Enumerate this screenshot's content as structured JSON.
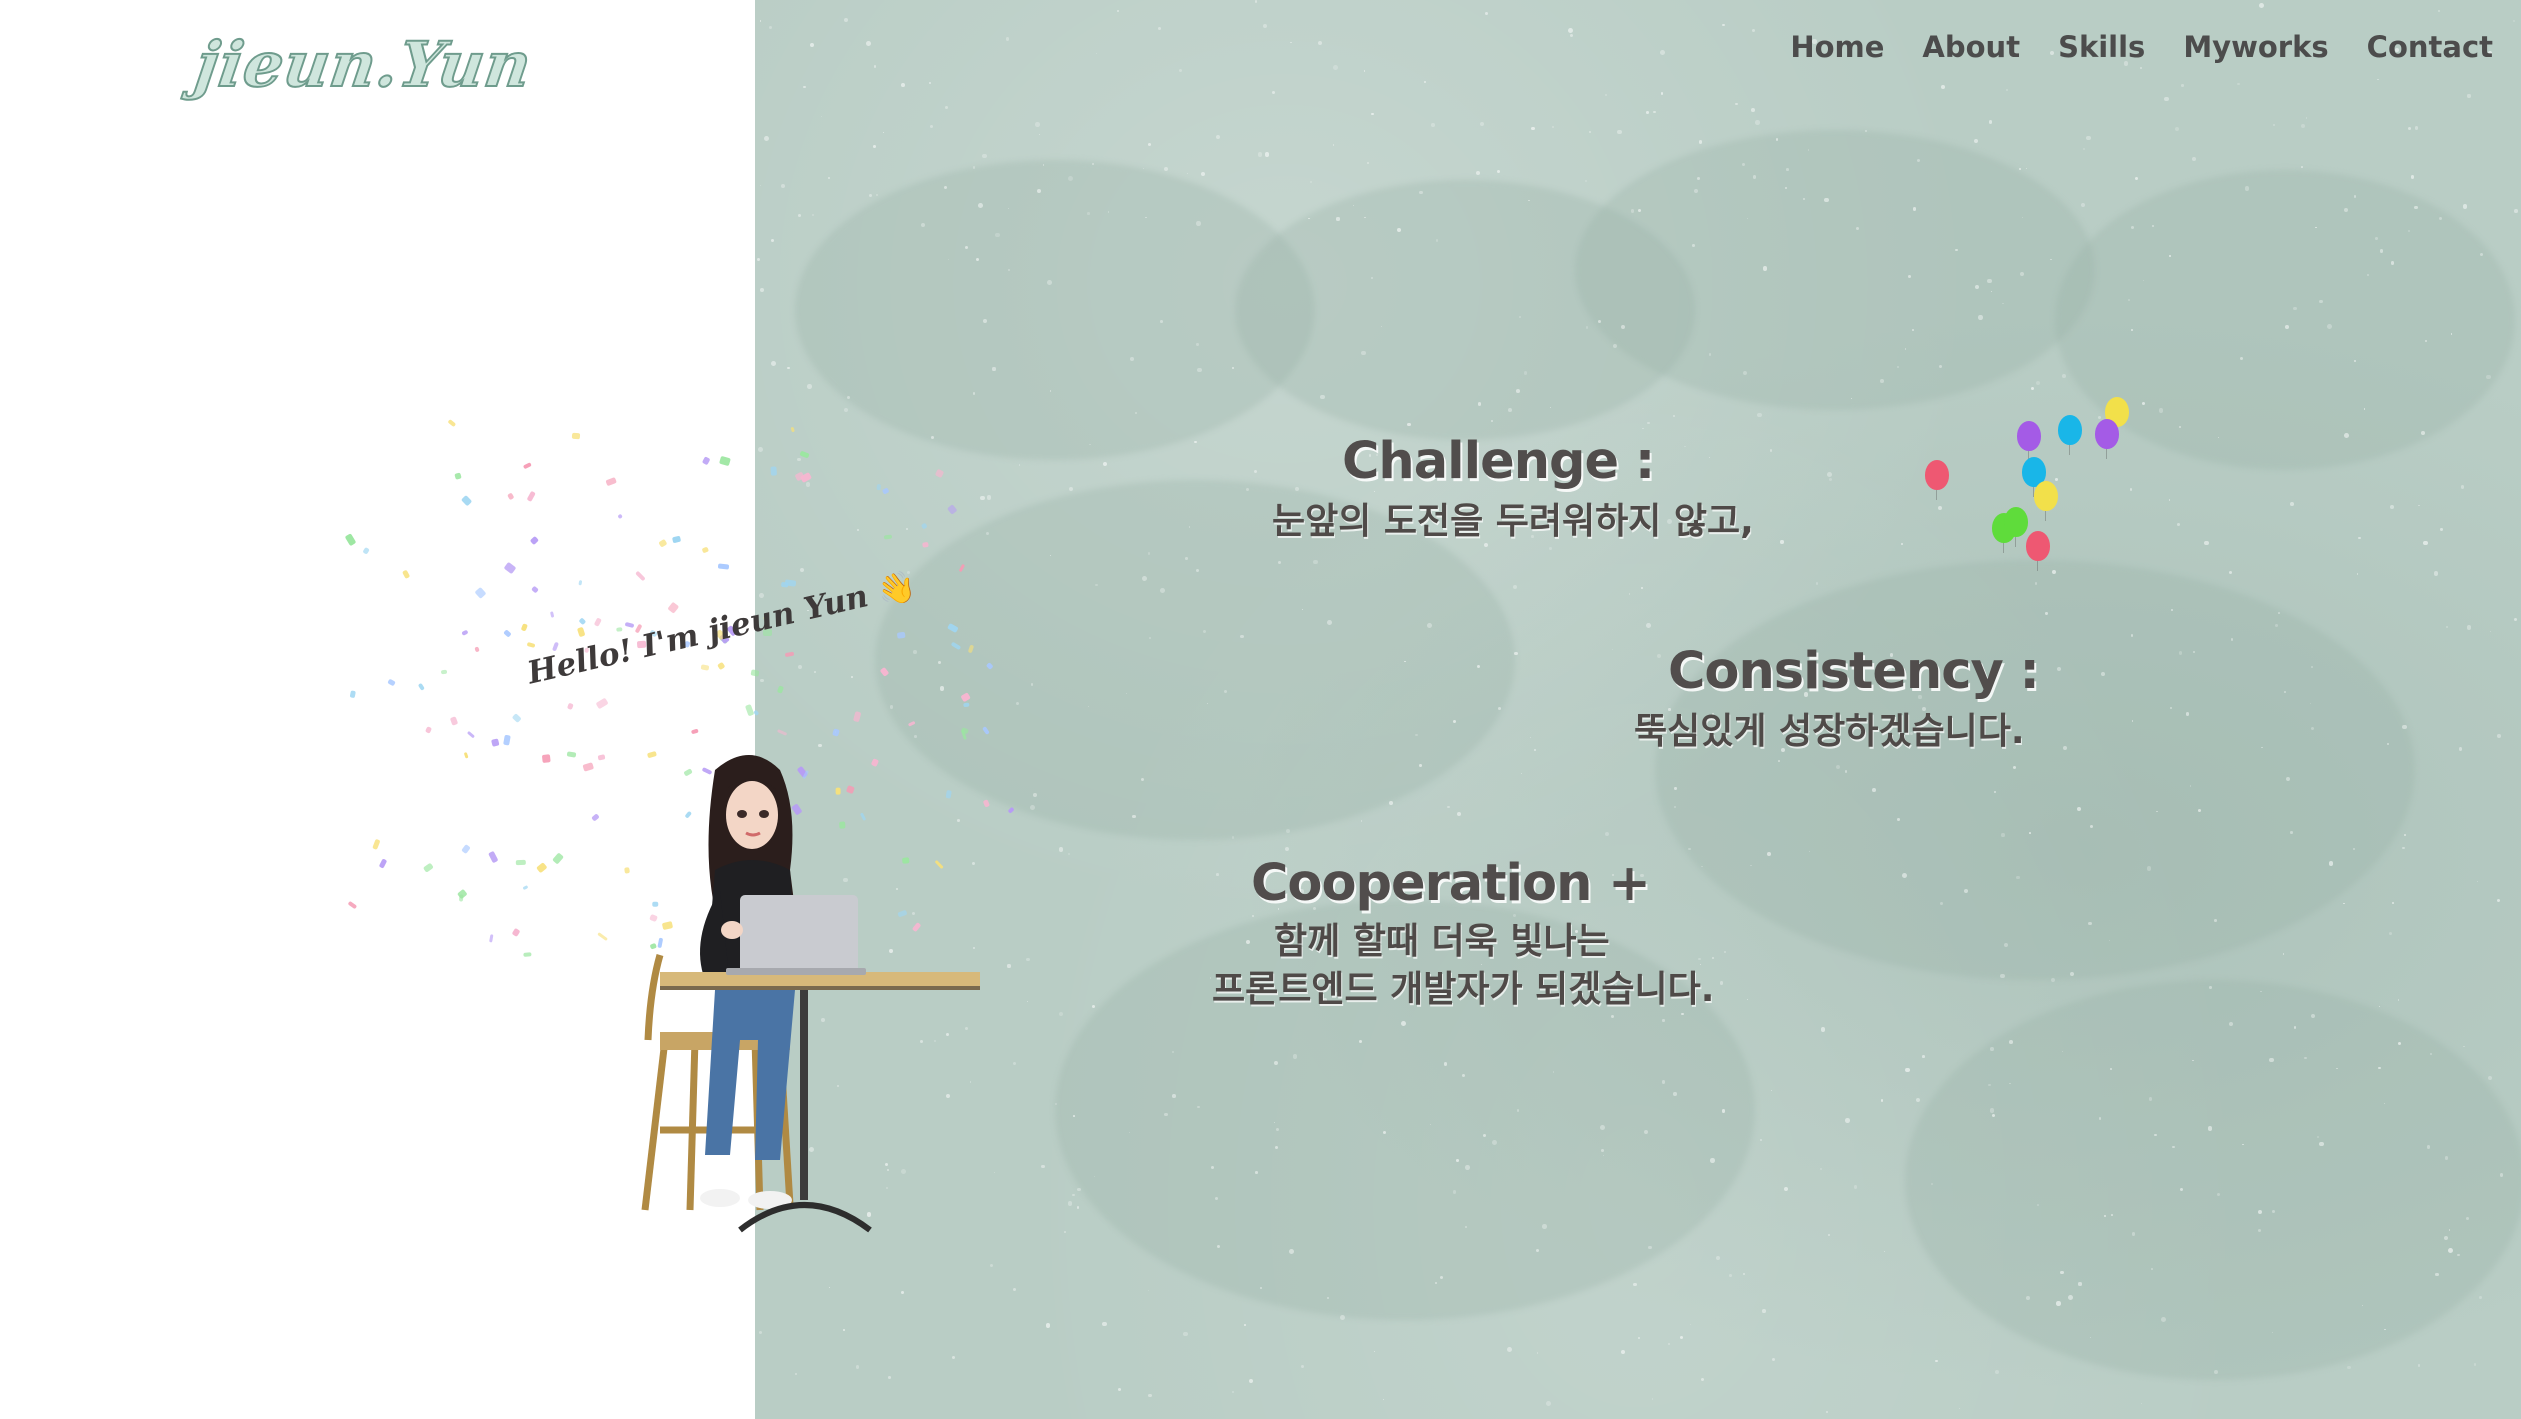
{
  "logo": {
    "text": "jieun.Yun"
  },
  "nav": {
    "items": [
      {
        "label": "Home"
      },
      {
        "label": "About"
      },
      {
        "label": "Skills"
      },
      {
        "label": "Myworks"
      },
      {
        "label": "Contact"
      }
    ]
  },
  "hero": {
    "greeting": "Hello! I'm jieun Yun",
    "greeting_emoji": "👋",
    "values": [
      {
        "title": "Challenge :",
        "lines": [
          "눈앞의 도전을 두려워하지 않고,"
        ]
      },
      {
        "title": "Consistency :",
        "lines": [
          "뚝심있게 성장하겠습니다."
        ]
      },
      {
        "title": "Cooperation +",
        "lines": [
          "함께 할때 더욱 빛나는",
          "프론트엔드 개발자가 되겠습니다."
        ]
      }
    ]
  },
  "colors": {
    "panel_background": "#b9cdc5",
    "heading_text": "#514d4c",
    "nav_text": "#4c4c4c",
    "logo_fill": "#cfe6dd",
    "logo_outline": "#6f9c8d",
    "balloon_colors": [
      "#ee5872",
      "#a45be6",
      "#19b6e8",
      "#f2e04a",
      "#5fdc3b"
    ]
  },
  "icons": {
    "illustration": "girl-with-laptop-at-table",
    "balloons": "balloons-cluster",
    "confetti": "confetti-burst"
  }
}
